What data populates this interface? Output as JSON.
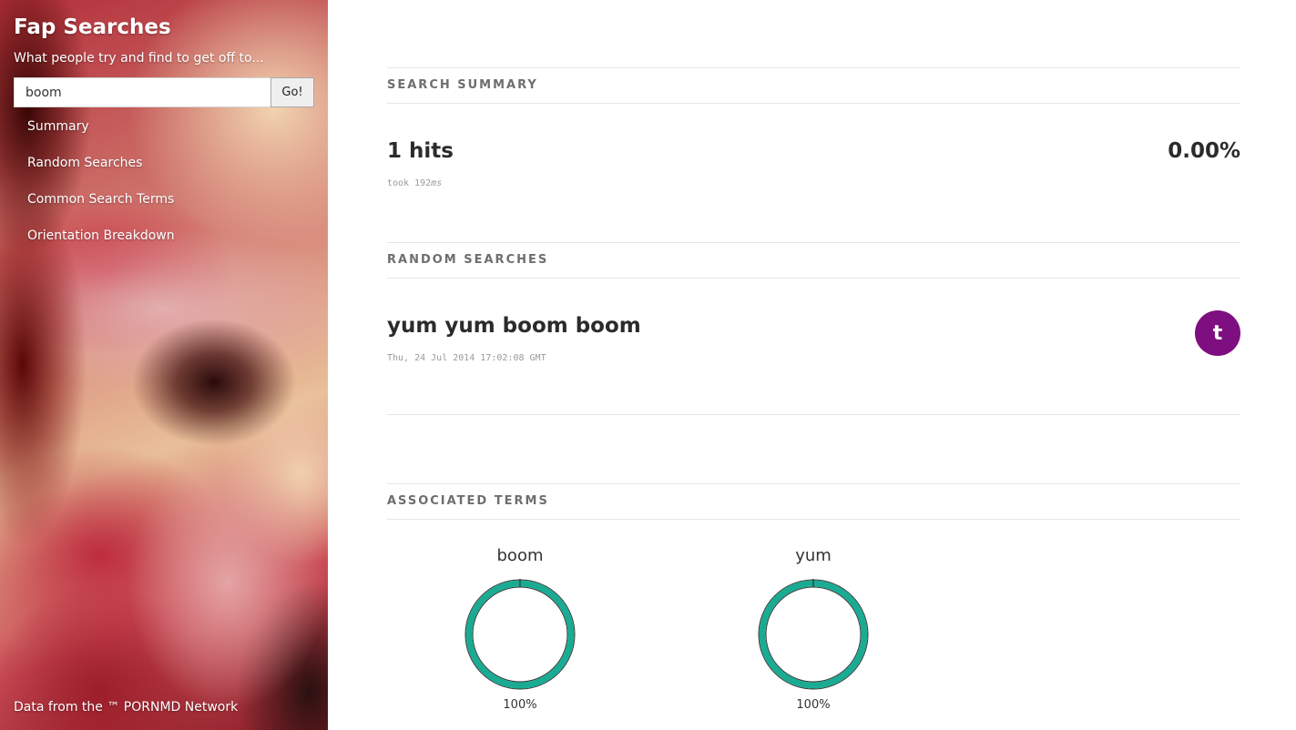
{
  "sidebar": {
    "title": "Fap Searches",
    "subtitle": "What people try and find to get off to...",
    "search": {
      "value": "boom",
      "button": "Go!"
    },
    "nav": [
      {
        "label": "Summary"
      },
      {
        "label": "Random Searches"
      },
      {
        "label": "Common Search Terms"
      },
      {
        "label": "Orientation Breakdown"
      }
    ],
    "footer": "Data from the ™ PORNMD Network"
  },
  "summary": {
    "heading": "Search Summary",
    "hits": "1 hits",
    "took_prefix": "took 192",
    "took_unit": "ms",
    "percent": "0.00%"
  },
  "random": {
    "heading": "Random Searches",
    "item": {
      "query": "yum yum boom boom",
      "date": "Thu, 24 Jul 2014 17:02:08 GMT",
      "avatar_letter": "t",
      "avatar_color": "#7e0f80"
    }
  },
  "associated": {
    "heading": "Associated Terms",
    "ring_color": "#1aab93",
    "terms": [
      {
        "label": "boom",
        "fraction": 1.0,
        "percent": "100%"
      },
      {
        "label": "yum",
        "fraction": 1.0,
        "percent": "100%"
      }
    ]
  }
}
